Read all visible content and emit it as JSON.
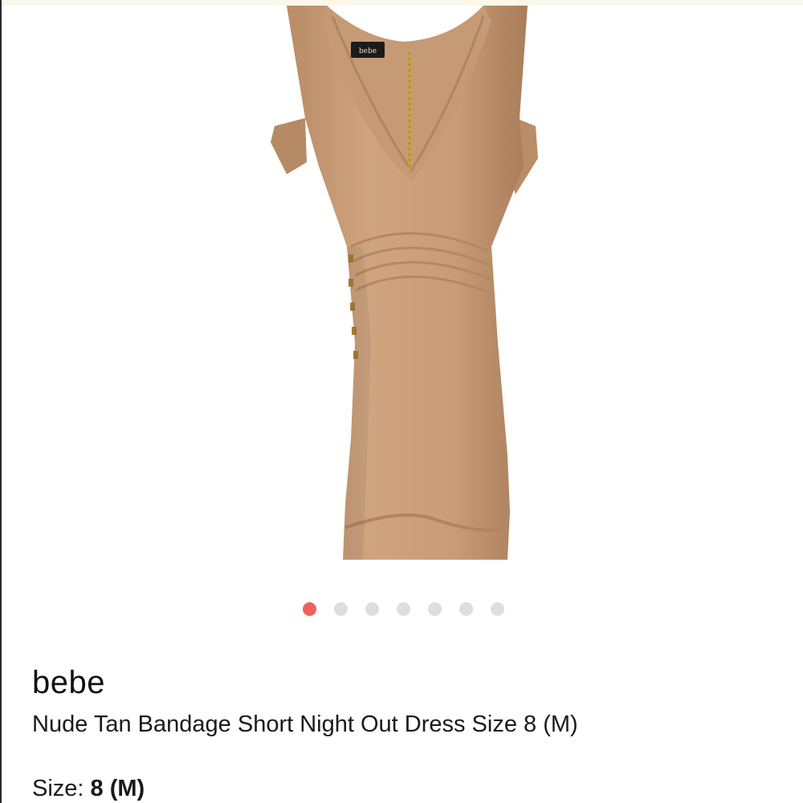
{
  "carousel": {
    "total_images": 7,
    "active_index": 0,
    "colors": {
      "active_dot": "#f0605d",
      "inactive_dot": "#dedede"
    }
  },
  "product_image": {
    "subject": "dress-photo",
    "garment_color": "#c9a07b",
    "tag_text": "bebe"
  },
  "listing": {
    "brand": "bebe",
    "title": "Nude Tan Bandage Short Night Out Dress Size 8 (M)",
    "size_label": "Size:",
    "size_value": "8 (M)"
  }
}
